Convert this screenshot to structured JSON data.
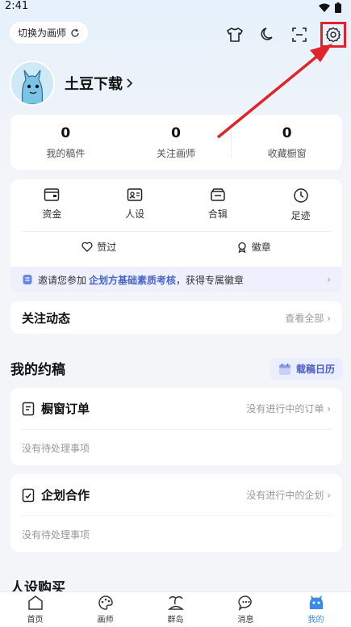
{
  "status_bar": {
    "time": "2:41"
  },
  "header": {
    "switch_label": "切换为画师"
  },
  "profile": {
    "name": "土豆下载"
  },
  "stats": [
    {
      "value": "0",
      "label": "我的稿件"
    },
    {
      "value": "0",
      "label": "关注画师"
    },
    {
      "value": "0",
      "label": "收藏橱窗"
    }
  ],
  "tools": [
    {
      "label": "资金",
      "icon": "wallet-icon"
    },
    {
      "label": "人设",
      "icon": "profile-card-icon"
    },
    {
      "label": "合辑",
      "icon": "collection-icon"
    },
    {
      "label": "足迹",
      "icon": "clock-icon"
    }
  ],
  "secondary_tools": [
    {
      "label": "赞过",
      "icon": "heart-icon"
    },
    {
      "label": "徽章",
      "icon": "badge-icon"
    }
  ],
  "invite": {
    "prefix": "邀请您参加",
    "highlight": "企划方基础素质考核",
    "suffix": "，获得专属徽章"
  },
  "follow": {
    "title": "关注动态",
    "view_all": "查看全部"
  },
  "commission": {
    "title": "我的约稿",
    "calendar_label": "载稿日历"
  },
  "window_orders": {
    "title": "橱窗订单",
    "status": "没有进行中的订单",
    "empty": "没有待处理事项"
  },
  "planning": {
    "title": "企划合作",
    "status": "没有进行中的企划",
    "empty": "没有待处理事项"
  },
  "section_next": {
    "title": "人设购买"
  },
  "tabbar": [
    {
      "label": "首页",
      "icon": "home-icon"
    },
    {
      "label": "画师",
      "icon": "palette-icon"
    },
    {
      "label": "群岛",
      "icon": "island-icon"
    },
    {
      "label": "消息",
      "icon": "message-icon"
    },
    {
      "label": "我的",
      "icon": "me-icon",
      "active": true
    }
  ],
  "colors": {
    "accent": "#3a8ce8",
    "highlight": "#e0242a",
    "invite_text": "#4a63c8"
  }
}
